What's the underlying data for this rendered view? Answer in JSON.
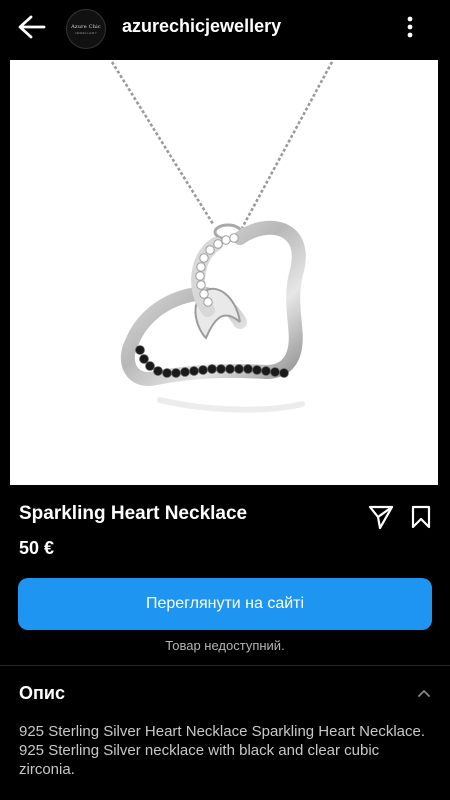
{
  "header": {
    "username": "azurechicjewellery",
    "avatar_logo": "Azure Chic",
    "avatar_sub": "JEWELLERY",
    "back_icon": "arrow-left-icon",
    "more_icon": "more-vertical-icon"
  },
  "product": {
    "image": "heart-necklace-image",
    "title": "Sparkling Heart Necklace",
    "price": "50 €",
    "share_icon": "send-icon",
    "save_icon": "bookmark-icon",
    "cta_label": "Переглянути на сайті",
    "status_text": "Товар недоступний."
  },
  "description": {
    "title": "Опис",
    "text": "925 Sterling Silver Heart Necklace Sparkling Heart Necklace. 925 Sterling Silver necklace with black and clear cubic zirconia.",
    "chevron_icon": "chevron-up-icon"
  },
  "colors": {
    "background": "#000000",
    "accent": "#1f95f2",
    "muted_text": "#b5b5b5"
  }
}
